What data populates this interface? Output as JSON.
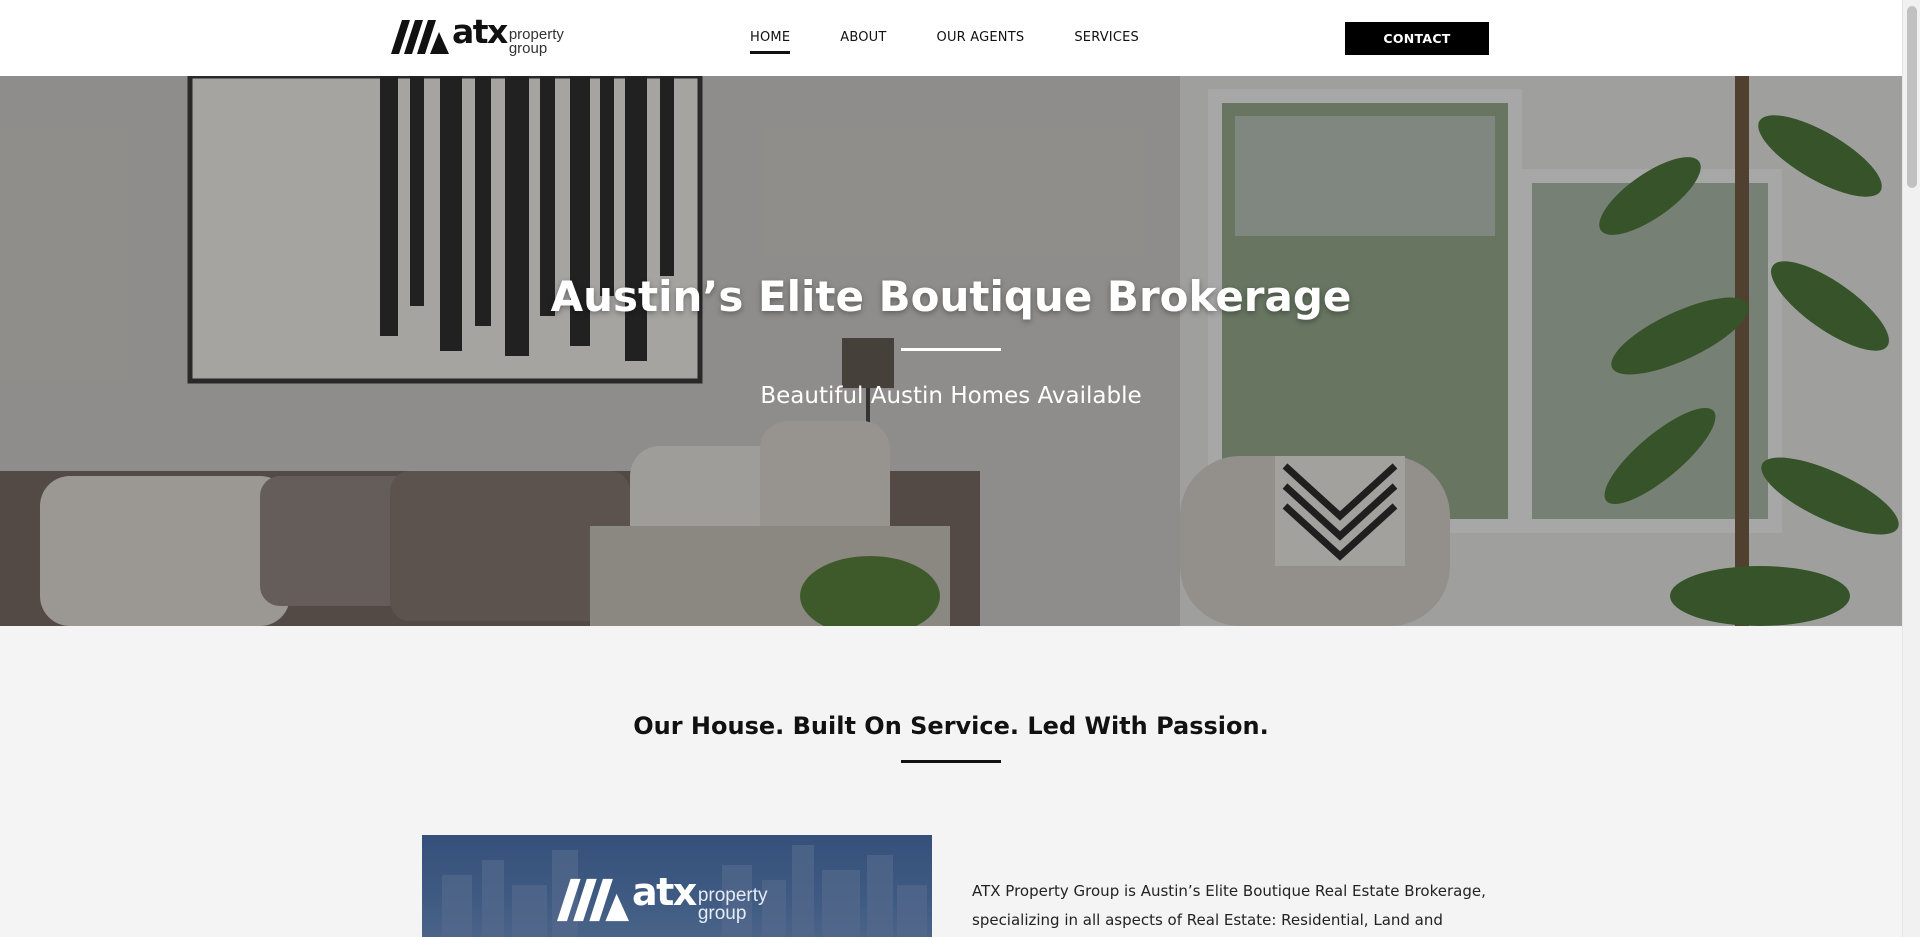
{
  "header": {
    "logo": {
      "main": "atx",
      "line1": "property",
      "line2": "group"
    },
    "nav": [
      {
        "label": "HOME",
        "active": true
      },
      {
        "label": "ABOUT",
        "active": false
      },
      {
        "label": "OUR AGENTS",
        "active": false
      },
      {
        "label": "SERVICES",
        "active": false
      }
    ],
    "contact_label": "CONTACT"
  },
  "hero": {
    "title": "Austin’s Elite Boutique Brokerage",
    "subtitle": "Beautiful Austin Homes Available"
  },
  "about": {
    "heading": "Our House. Built On Service. Led With Passion.",
    "image_logo": {
      "main": "atx",
      "line1": "property",
      "line2": "group"
    },
    "text": "ATX Property Group is Austin’s Elite Boutique Real Estate Brokerage, specializing in all aspects of Real Estate: Residential, Land and Ranch,"
  },
  "colors": {
    "accent": "#000000",
    "background": "#f4f4f4",
    "header_bg": "#ffffff"
  }
}
